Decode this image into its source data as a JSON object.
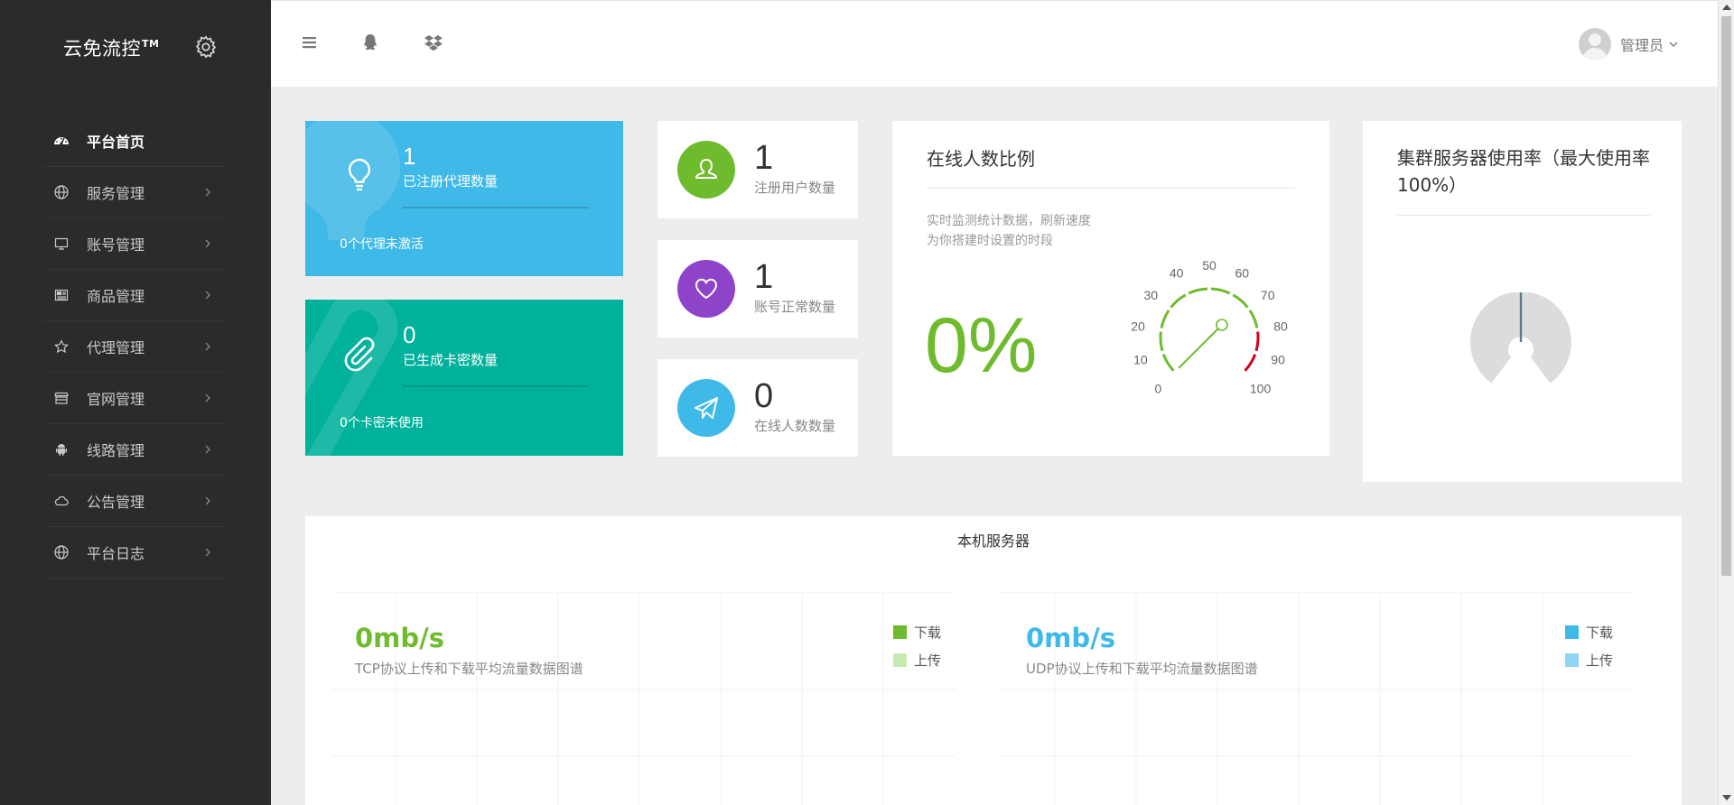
{
  "brand": {
    "name": "云免流控",
    "tm": "TM"
  },
  "sidebar": {
    "items": [
      {
        "label": "平台首页",
        "icon": "dashboard-icon"
      },
      {
        "label": "服务管理",
        "icon": "globe-icon"
      },
      {
        "label": "账号管理",
        "icon": "monitor-icon"
      },
      {
        "label": "商品管理",
        "icon": "newspaper-icon"
      },
      {
        "label": "代理管理",
        "icon": "star-icon"
      },
      {
        "label": "官网管理",
        "icon": "store-icon"
      },
      {
        "label": "线路管理",
        "icon": "android-icon"
      },
      {
        "label": "公告管理",
        "icon": "cloud-icon"
      },
      {
        "label": "平台日志",
        "icon": "globe-icon"
      }
    ]
  },
  "header": {
    "user_name": "管理员"
  },
  "tiles": {
    "agents": {
      "value": "1",
      "label": "已注册代理数量",
      "footer": "0个代理未激活",
      "color": "#3fb9e8"
    },
    "cards": {
      "value": "0",
      "label": "已生成卡密数量",
      "footer": "0个卡密未使用",
      "color": "#00b19b"
    }
  },
  "small_cards": [
    {
      "value": "1",
      "label": "注册用户数量",
      "color": "#6fbb2e",
      "icon": "user-icon"
    },
    {
      "value": "1",
      "label": "账号正常数量",
      "color": "#8e44c8",
      "icon": "heart-icon"
    },
    {
      "value": "0",
      "label": "在线人数数量",
      "color": "#3fb9e8",
      "icon": "paper-plane-icon"
    }
  ],
  "online_panel": {
    "title": "在线人数比例",
    "description": "实时监测统计数据，刷新速度为你搭建时设置的时段",
    "percent": "0%",
    "gauge_value": 0,
    "gauge_ticks": [
      "0",
      "10",
      "20",
      "30",
      "40",
      "50",
      "60",
      "70",
      "80",
      "90",
      "100"
    ],
    "gauge_color": "#6fbb2e",
    "gauge_danger_color": "#d0021b"
  },
  "cluster_panel": {
    "title": "集群服务器使用率（最大使用率100%）"
  },
  "local_panel": {
    "title": "本机服务器",
    "tcp": {
      "speed": "0mb/s",
      "subtitle": "TCP协议上传和下载平均流量数据图谱",
      "color": "#6fbb2e",
      "legend": [
        "下载",
        "上传"
      ],
      "legend_colors": [
        "#6fbb2e",
        "#c7eab0"
      ]
    },
    "udp": {
      "speed": "0mb/s",
      "subtitle": "UDP协议上传和下载平均流量数据图谱",
      "color": "#3fb9e8",
      "legend": [
        "下载",
        "上传"
      ],
      "legend_colors": [
        "#3fb9e8",
        "#8fd5f3"
      ]
    }
  }
}
